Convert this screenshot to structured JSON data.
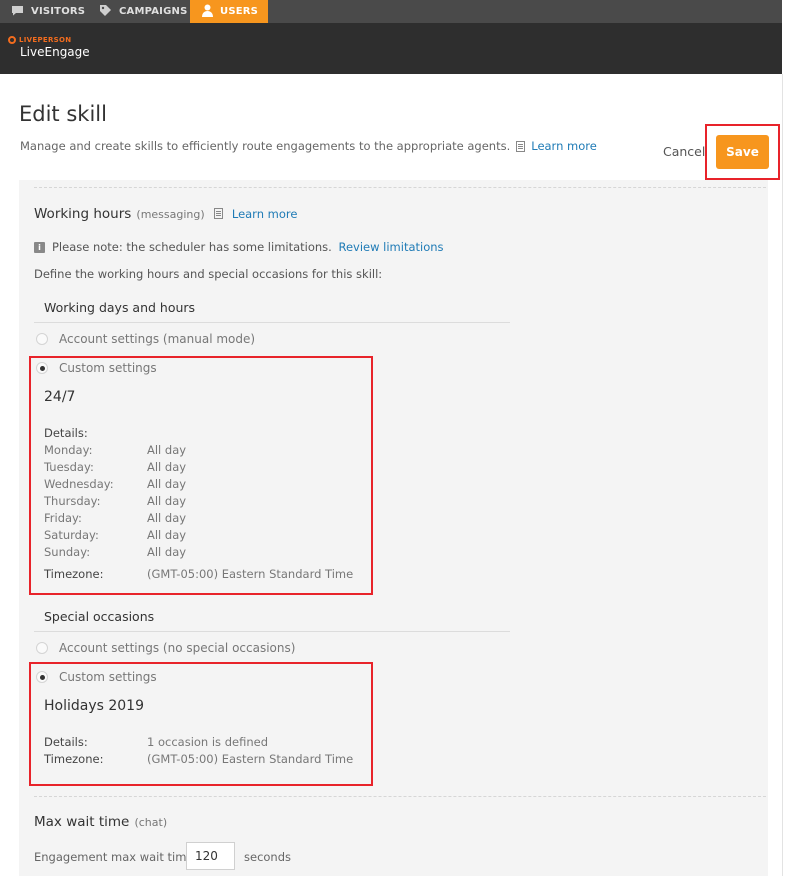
{
  "nav": {
    "tabs": [
      {
        "label": "VISITORS",
        "icon": "speech-bubble-icon"
      },
      {
        "label": "CAMPAIGNS",
        "icon": "tag-icon"
      },
      {
        "label": "USERS",
        "icon": "user-icon"
      }
    ]
  },
  "brand": {
    "small": "LIVEPERSON",
    "big": "LiveEngage"
  },
  "page": {
    "title": "Edit skill",
    "subtitle": "Manage and create skills to efficiently route engagements to the appropriate agents.",
    "learn_more": "Learn more",
    "cancel": "Cancel",
    "save": "Save"
  },
  "working_hours": {
    "title": "Working hours",
    "qualifier": "(messaging)",
    "learn_more": "Learn more",
    "note": "Please note: the scheduler has some limitations.",
    "review_link": "Review limitations",
    "define_text": "Define the working hours and special occasions for this skill:",
    "days_section": "Working days and hours",
    "option_account": "Account settings (manual mode)",
    "option_custom": "Custom settings",
    "schedule_name": "24/7",
    "details_label": "Details:",
    "days": [
      {
        "day": "Monday:",
        "value": "All day"
      },
      {
        "day": "Tuesday:",
        "value": "All day"
      },
      {
        "day": "Wednesday:",
        "value": "All day"
      },
      {
        "day": "Thursday:",
        "value": "All day"
      },
      {
        "day": "Friday:",
        "value": "All day"
      },
      {
        "day": "Saturday:",
        "value": "All day"
      },
      {
        "day": "Sunday:",
        "value": "All day"
      }
    ],
    "timezone_label": "Timezone:",
    "timezone_value": "(GMT-05:00) Eastern Standard Time"
  },
  "special_occasions": {
    "section": "Special occasions",
    "option_account": "Account settings (no special occasions)",
    "option_custom": "Custom settings",
    "name": "Holidays 2019",
    "details_label": "Details:",
    "details_value": "1 occasion is defined",
    "timezone_label": "Timezone:",
    "timezone_value": "(GMT-05:00) Eastern Standard Time"
  },
  "max_wait": {
    "title": "Max wait time",
    "qualifier": "(chat)",
    "field_label": "Engagement max wait time",
    "value": "120",
    "unit": "seconds"
  }
}
